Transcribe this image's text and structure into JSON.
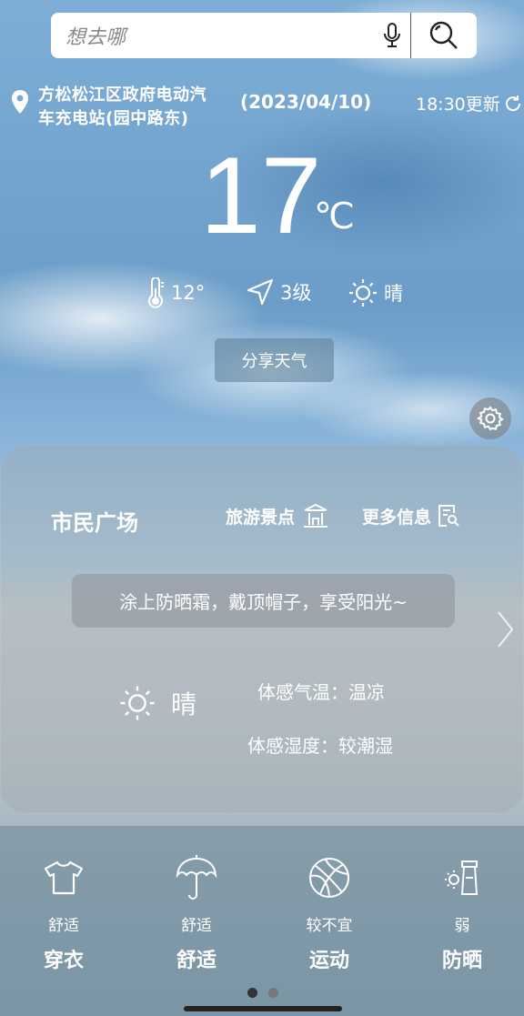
{
  "search": {
    "placeholder": "想去哪"
  },
  "location": {
    "line1": "方松松江区政府电动汽",
    "line2": "车充电站(园中路东)"
  },
  "date": "(2023/04/10)",
  "update_time": "18:30更新",
  "temperature": {
    "value": "17",
    "unit": "℃"
  },
  "stats": {
    "low": "12°",
    "wind": "3级",
    "condition": "晴"
  },
  "share_label": "分享天气",
  "card": {
    "place": "市民广场",
    "scenic_label": "旅游景点",
    "more_label": "更多信息",
    "tip": "涂上防晒霜，戴顶帽子，享受阳光~",
    "condition": "晴",
    "feel_temp": "体感气温：温凉",
    "feel_humidity": "体感湿度：较潮湿"
  },
  "life_index": [
    {
      "icon": "shirt-icon",
      "level": "舒适",
      "name": "穿衣"
    },
    {
      "icon": "umbrella-icon",
      "level": "舒适",
      "name": "舒适"
    },
    {
      "icon": "basketball-icon",
      "level": "较不宜",
      "name": "运动"
    },
    {
      "icon": "sunscreen-icon",
      "level": "弱",
      "name": "防晒"
    }
  ],
  "pager": {
    "current": 1,
    "total": 2
  },
  "colors": {
    "search_bg": "#ffffff",
    "text": "#ffffff",
    "active_dot": "#333333"
  }
}
